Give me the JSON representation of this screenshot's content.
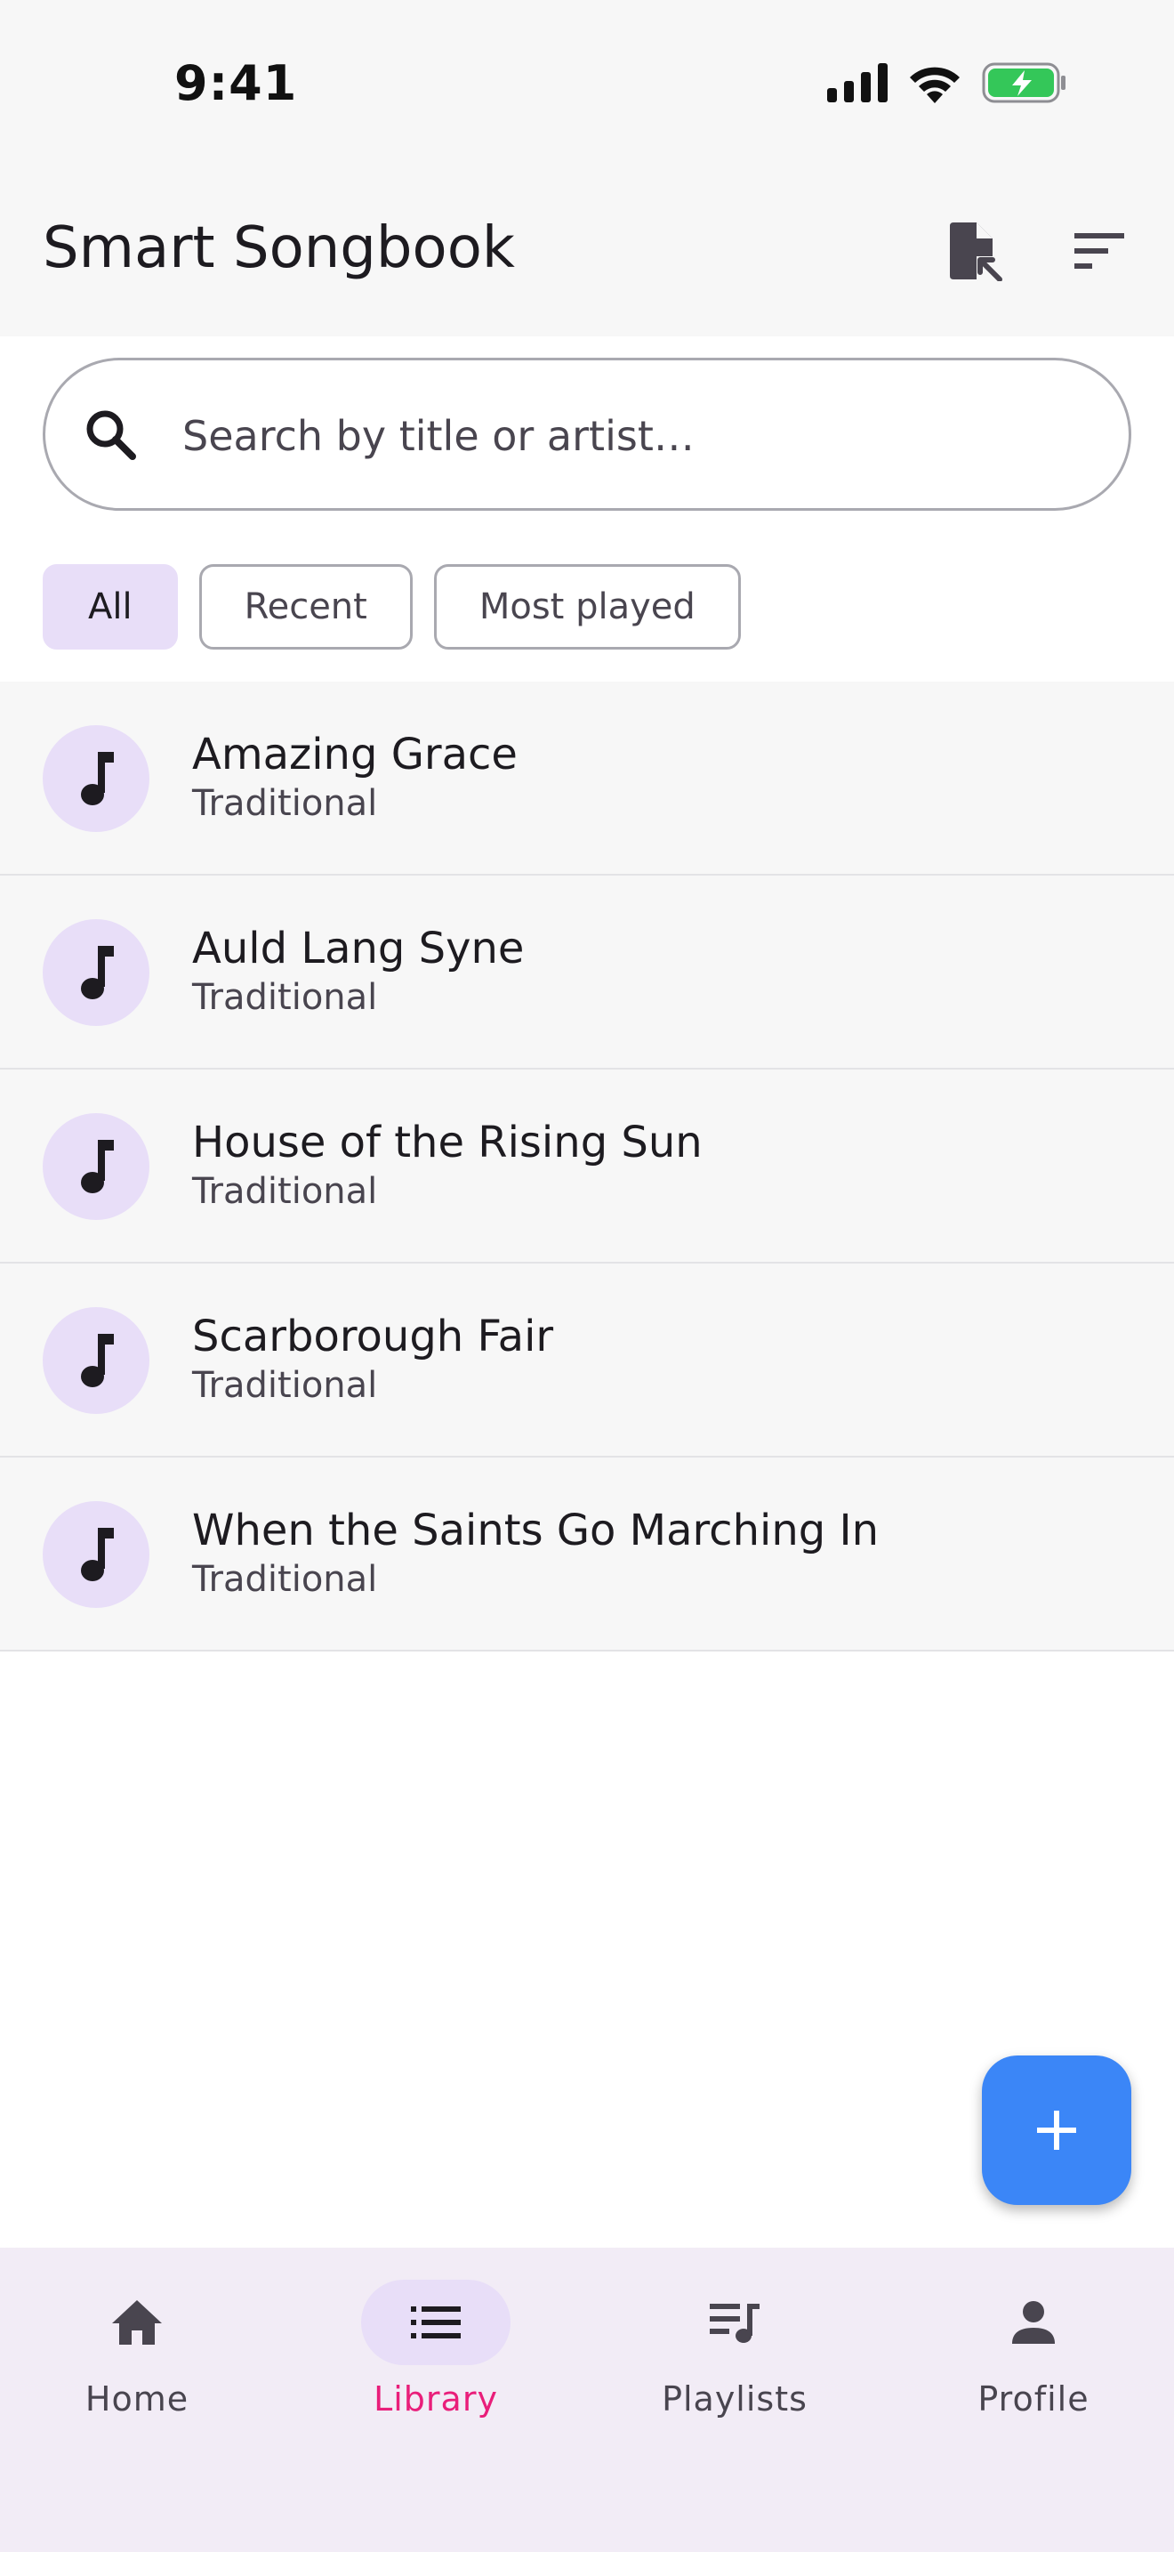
{
  "status_bar": {
    "time": "9:41",
    "icons": [
      "signal-icon",
      "wifi-icon",
      "battery-charging-icon"
    ]
  },
  "app_bar": {
    "title": "Smart Songbook",
    "actions": [
      "file-import-icon",
      "sort-icon"
    ]
  },
  "search": {
    "placeholder": "Search by title or artist…",
    "value": ""
  },
  "filters": [
    {
      "label": "All",
      "selected": true
    },
    {
      "label": "Recent",
      "selected": false
    },
    {
      "label": "Most played",
      "selected": false
    }
  ],
  "songs": [
    {
      "title": "Amazing Grace",
      "artist": "Traditional"
    },
    {
      "title": "Auld Lang Syne",
      "artist": "Traditional"
    },
    {
      "title": "House of the Rising Sun",
      "artist": "Traditional"
    },
    {
      "title": "Scarborough Fair",
      "artist": "Traditional"
    },
    {
      "title": "When the Saints Go Marching In",
      "artist": "Traditional"
    }
  ],
  "fab": {
    "icon": "plus-icon"
  },
  "bottom_nav": {
    "items": [
      {
        "label": "Home",
        "icon": "home-icon",
        "active": false
      },
      {
        "label": "Library",
        "icon": "list-icon",
        "active": true
      },
      {
        "label": "Playlists",
        "icon": "queue-music-icon",
        "active": false
      },
      {
        "label": "Profile",
        "icon": "person-icon",
        "active": false
      }
    ]
  },
  "colors": {
    "accent": "#3b86f7",
    "selected_chip": "#e8def8",
    "active_nav_label": "#e91e7a",
    "nav_background": "#f2ecf6",
    "battery_green": "#34c759"
  }
}
